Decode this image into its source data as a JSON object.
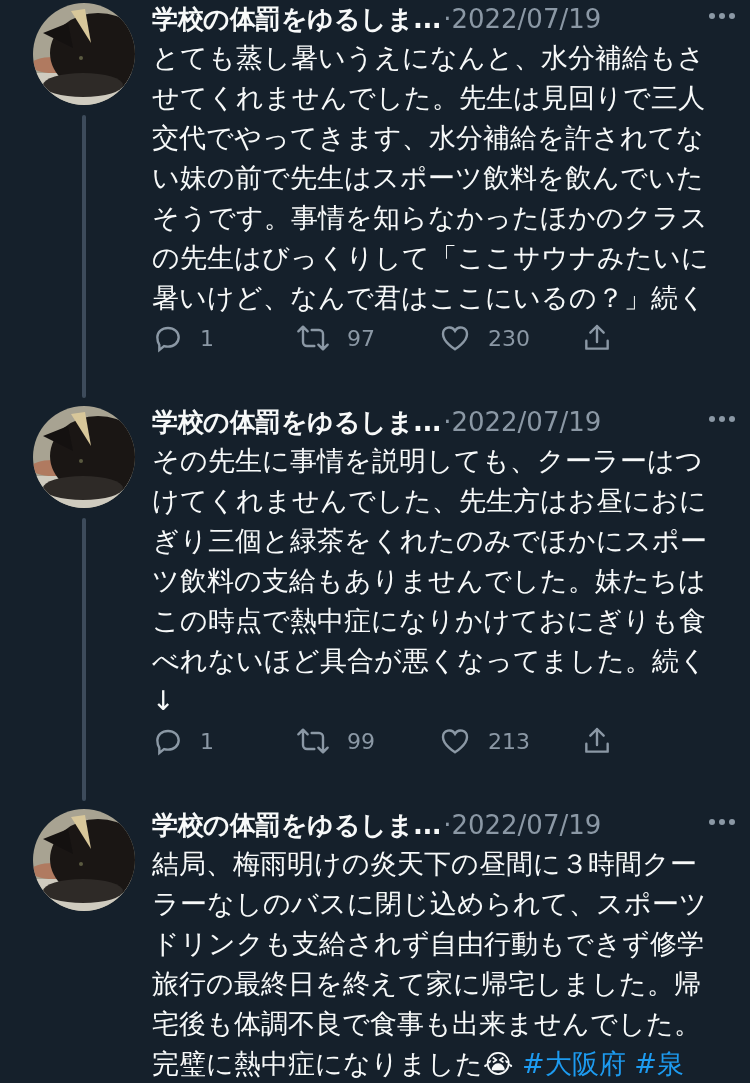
{
  "tweets": [
    {
      "author": "学校の体罰をゆるしま...",
      "date": "·2022/07/19",
      "text": "とても蒸し暑いうえになんと、水分補給もさせてくれませんでした。先生は見回りで三人交代でやってきます、水分補給を許されてない妹の前で先生はスポーツ飲料を飲んでいたそうです。事情を知らなかったほかのクラスの先生はびっくりして「ここサウナみたいに暑いけど、なんで君はここにいるの？」続く",
      "thread_line": true,
      "stats": {
        "replies": "1",
        "retweets": "97",
        "likes": "230"
      }
    },
    {
      "author": "学校の体罰をゆるしま...",
      "date": "·2022/07/19",
      "text": "その先生に事情を説明しても、クーラーはつけてくれませんでした、先生方はお昼におにぎり三個と緑茶をくれたのみでほかにスポーツ飲料の支給もありませんでした。妹たちはこの時点で熱中症になりかけておにぎりも食べれないほど具合が悪くなってました。続く↓",
      "thread_line": true,
      "stats": {
        "replies": "1",
        "retweets": "99",
        "likes": "213"
      }
    },
    {
      "author": "学校の体罰をゆるしま...",
      "date": "·2022/07/19",
      "text": "結局、梅雨明けの炎天下の昼間に３時間クーラーなしのバスに閉じ込められて、スポーツドリンクも支給されず自由行動もできず修学旅行の最終日を終えて家に帰宅しました。帰宅後も体調不良で食事も出来ませんでした。完璧に熱中症になりました",
      "emoji": "😭",
      "hashtags": [
        "#大阪府",
        "#泉"
      ],
      "thread_line": false
    }
  ]
}
